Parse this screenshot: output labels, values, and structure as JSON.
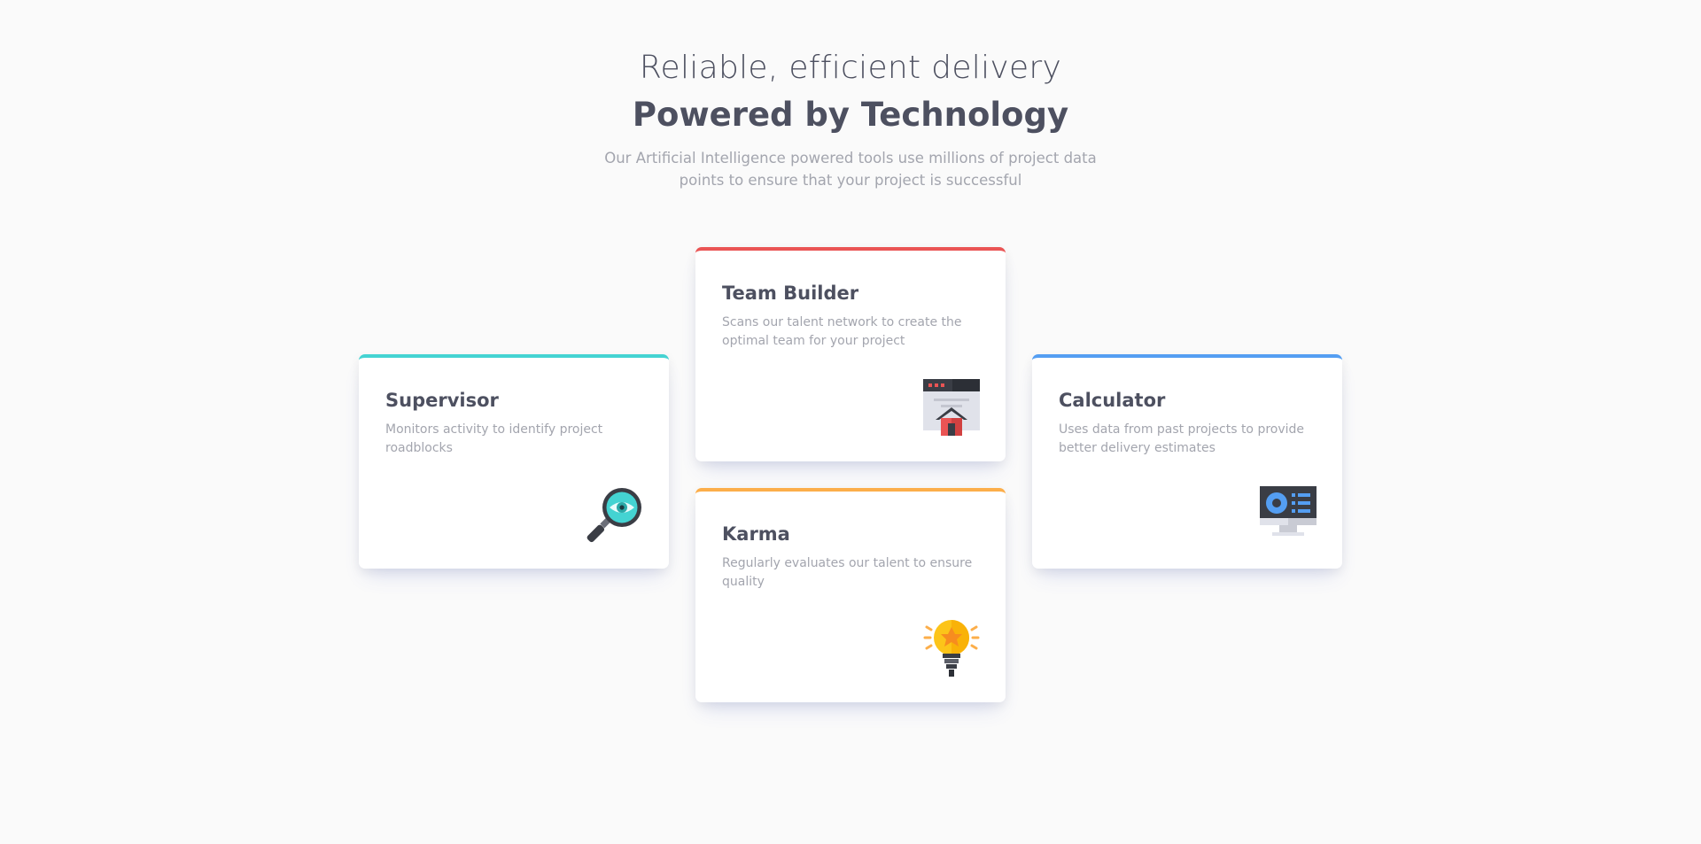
{
  "header": {
    "tagline": "Reliable, efficient delivery",
    "headline": "Powered by Technology",
    "intro": "Our Artificial Intelligence powered tools use millions of project data points to ensure that your project is successful"
  },
  "cards": [
    {
      "title": "Supervisor",
      "description": "Monitors activity to identify project roadblocks",
      "accent": "#44d3d2",
      "icon": "magnifier-eye-icon"
    },
    {
      "title": "Team Builder",
      "description": "Scans our talent network to create the optimal team for your project",
      "accent": "#ea5454",
      "icon": "browser-house-icon"
    },
    {
      "title": "Karma",
      "description": "Regularly evaluates our talent to ensure quality",
      "accent": "#fcae4a",
      "icon": "lightbulb-icon"
    },
    {
      "title": "Calculator",
      "description": "Uses data from past projects to provide better delivery estimates",
      "accent": "#549ef2",
      "icon": "monitor-chart-icon"
    }
  ],
  "colors": {
    "background": "#fafafa",
    "heading": "#4d5060",
    "body_text": "#a3a5ae",
    "card": "#ffffff"
  }
}
